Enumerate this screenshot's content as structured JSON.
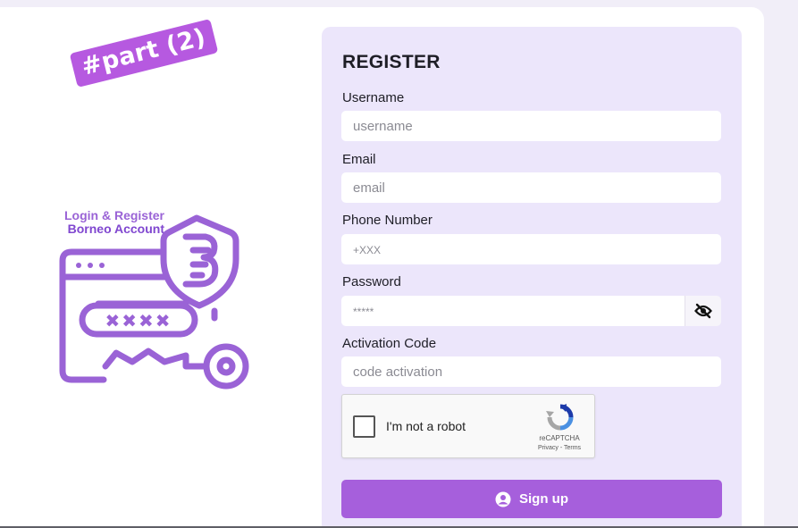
{
  "sticker": {
    "text": "#part (2)"
  },
  "illustration": {
    "title_line1": "Login & Register",
    "title_line2": "Borneo Account",
    "password_mask": "✖✖✖✖"
  },
  "form": {
    "title": "REGISTER",
    "username": {
      "label": "Username",
      "placeholder": "username",
      "value": ""
    },
    "email": {
      "label": "Email",
      "placeholder": "email",
      "value": ""
    },
    "phone": {
      "label": "Phone Number",
      "placeholder": "+XXX",
      "value": ""
    },
    "password": {
      "label": "Password",
      "placeholder": "*****",
      "value": "",
      "toggle_icon": "eye-slash-icon"
    },
    "activation": {
      "label": "Activation Code",
      "placeholder": "code activation",
      "value": ""
    },
    "captcha": {
      "label": "I'm not a robot",
      "brand": "reCAPTCHA",
      "links": "Privacy - Terms",
      "checked": false
    },
    "submit": {
      "label": "Sign up",
      "icon": "user-circle-icon"
    }
  },
  "colors": {
    "accent": "#a65fdc",
    "panel": "#ece6fb",
    "sticker": "#b659e0",
    "illustration": "#9a63d6"
  }
}
